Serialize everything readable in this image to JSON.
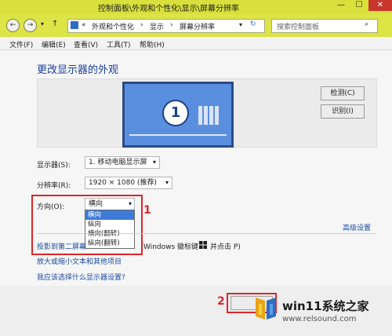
{
  "window": {
    "title": "控制面板\\外观和个性化\\显示\\屏幕分辨率",
    "min_label": "—",
    "max_label": "☐",
    "close_label": "✕"
  },
  "nav": {
    "breadcrumb": [
      "«",
      "外观和个性化",
      "›",
      "显示",
      "›",
      "屏幕分辨率"
    ],
    "search_placeholder": "搜索控制面板"
  },
  "menu": [
    "文件(F)",
    "编辑(E)",
    "查看(V)",
    "工具(T)",
    "帮助(H)"
  ],
  "main": {
    "title": "更改显示器的外观",
    "monitor_number": "1",
    "detect_label": "检测(C)",
    "identify_label": "识别(I)",
    "display_label": "显示器(S):",
    "display_value": "1. 移动电脑显示屏",
    "resolution_label": "分辨率(R):",
    "resolution_value": "1920 × 1080 (推荐)",
    "orientation_label": "方向(O):",
    "orientation_value": "横向",
    "orientation_options": [
      "横向",
      "纵向",
      "横向(翻转)",
      "纵向(翻转)"
    ],
    "advanced_link": "高级设置",
    "project_link": "投影到第二屏幕",
    "project_tail": "Windows 徽标键",
    "project_tail2": "并点击 P)",
    "text_link": "放大或缩小文本和其他项目",
    "choose_link": "我应该选择什么显示器设置?"
  },
  "annotations": {
    "marker1": "1",
    "marker2": "2"
  },
  "watermark": {
    "brand": "win11系统之家",
    "url": "www.relsound.com"
  },
  "colors": {
    "titlebar": "#d9e03c",
    "accent_red": "#d9272a",
    "link": "#1a4aa3"
  }
}
